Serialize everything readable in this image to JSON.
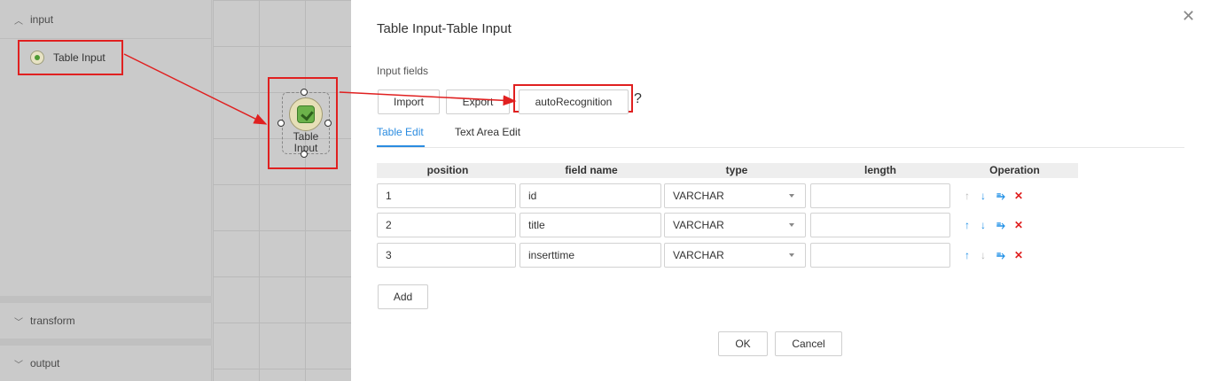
{
  "sidebar": {
    "sections": [
      {
        "label": "input",
        "expanded": true,
        "chevron_icon": "chevron-up-icon"
      },
      {
        "label": "transform",
        "expanded": false,
        "chevron_icon": "chevron-down-icon"
      },
      {
        "label": "output",
        "expanded": false,
        "chevron_icon": "chevron-down-icon"
      }
    ],
    "items": [
      {
        "label": "Table Input",
        "icon": "table-input-icon",
        "highlighted": true
      }
    ]
  },
  "canvas": {
    "node": {
      "label": "Table Input",
      "icon": "table-input-icon",
      "selected": true
    }
  },
  "dialog": {
    "title": "Table Input-Table Input",
    "close_icon": "close-icon",
    "section_label": "Input fields",
    "buttons": {
      "import": "Import",
      "export": "Export",
      "auto_recognition": "autoRecognition",
      "help": "?"
    },
    "tabs": [
      {
        "label": "Table Edit",
        "active": true
      },
      {
        "label": "Text Area Edit",
        "active": false
      }
    ],
    "table": {
      "columns": [
        "position",
        "field name",
        "type",
        "length",
        "Operation"
      ],
      "rows": [
        {
          "position": "1",
          "field_name": "id",
          "type": "VARCHAR",
          "length": "",
          "can_move_up": false,
          "can_move_down": true
        },
        {
          "position": "2",
          "field_name": "title",
          "type": "VARCHAR",
          "length": "",
          "can_move_up": true,
          "can_move_down": true
        },
        {
          "position": "3",
          "field_name": "inserttime",
          "type": "VARCHAR",
          "length": "",
          "can_move_up": true,
          "can_move_down": false
        }
      ]
    },
    "add_label": "Add",
    "ok_label": "OK",
    "cancel_label": "Cancel"
  },
  "colors": {
    "accent": "#2b8ce0",
    "annotation": "#e02020",
    "overlay": "#c9c9c9"
  }
}
